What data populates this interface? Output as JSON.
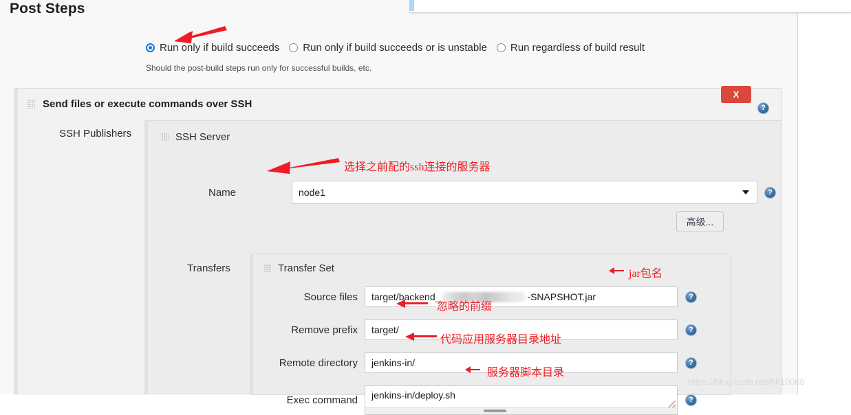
{
  "page": {
    "title": "Post Steps",
    "watermark": "https://blog.csdn.net/hk10066"
  },
  "post_steps": {
    "radio_options": [
      {
        "label": "Run only if build succeeds",
        "selected": true
      },
      {
        "label": "Run only if build succeeds or is unstable",
        "selected": false
      },
      {
        "label": "Run regardless of build result",
        "selected": false
      }
    ],
    "hint": "Should the post-build steps run only for successful builds, etc."
  },
  "ssh_panel": {
    "title": "Send files or execute commands over SSH",
    "close_label": "X",
    "help_icon": "help-icon",
    "drag_handle_icon": "drag-handle-icon",
    "publishers_label": "SSH Publishers",
    "server_section_title": "SSH Server",
    "name_label": "Name",
    "name_value": "node1",
    "name_caret_icon": "chevron-down-icon",
    "advanced_button": "高级...",
    "transfers_label": "Transfers",
    "transfer_set_title": "Transfer Set",
    "fields": [
      {
        "label": "Source files",
        "value_prefix": "target/backend_",
        "value_suffix": "-SNAPSHOT.jar",
        "redacted": true
      },
      {
        "label": "Remove prefix",
        "value": "target/",
        "redacted": false
      },
      {
        "label": "Remote directory",
        "value": "jenkins-in/",
        "redacted": false
      },
      {
        "label": "Exec command",
        "value": "jenkins-in/deploy.sh",
        "redacted": false
      }
    ]
  },
  "annotations": [
    {
      "id": "server-note",
      "text": "选择之前配的ssh连接的服务器"
    },
    {
      "id": "jar-note",
      "text": "jar包名"
    },
    {
      "id": "prefix-note",
      "text": "忽略的前缀"
    },
    {
      "id": "dir-note",
      "text": "代码应用服务器目录地址"
    },
    {
      "id": "script-note",
      "text": "服务器脚本目录"
    }
  ]
}
